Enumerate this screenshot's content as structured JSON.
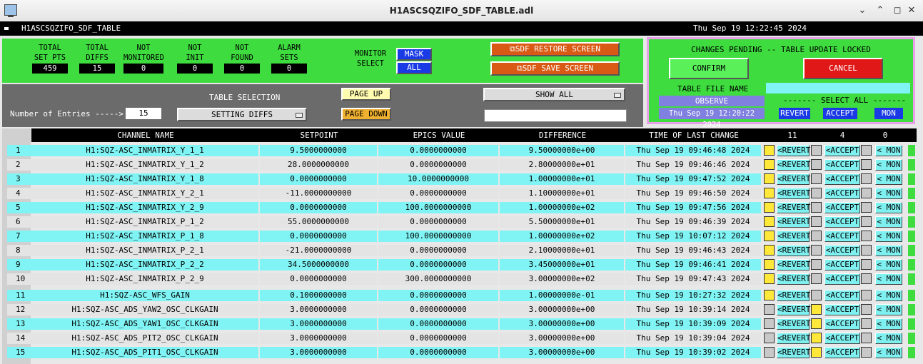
{
  "window": {
    "title": "H1ASCSQZIFO_SDF_TABLE.adl"
  },
  "header": {
    "screen_name": "H1ASCSQZIFO_SDF_TABLE",
    "datetime": "Thu Sep 19 12:22:45 2024"
  },
  "stats": [
    {
      "label": "TOTAL\nSET PTS",
      "value": "459"
    },
    {
      "label": "TOTAL\nDIFFS",
      "value": "15"
    },
    {
      "label": "NOT\nMONITORED",
      "value": "0"
    },
    {
      "label": "NOT\nINIT",
      "value": "0"
    },
    {
      "label": "NOT\nFOUND",
      "value": "0"
    },
    {
      "label": "ALARM\nSETS",
      "value": "0"
    }
  ],
  "monitor_select": {
    "label1": "MONITOR",
    "label2": "SELECT",
    "mask": "MASK",
    "all": "ALL"
  },
  "screens": {
    "restore": "SDF RESTORE SCREEN",
    "save": "SDF SAVE SCREEN"
  },
  "pending": {
    "title": "CHANGES PENDING -- TABLE UPDATE LOCKED",
    "confirm": "CONFIRM",
    "cancel": "CANCEL",
    "file_label": "TABLE FILE NAME",
    "file_value": "OBSERVE",
    "file_time": "Thu Sep 19 12:20:22 2024",
    "select_all": "------- SELECT ALL -------",
    "revert": "REVERT",
    "accept": "ACCEPT",
    "mon": "MON"
  },
  "table_controls": {
    "entries_label": "Number of Entries ----->",
    "entries_value": "15",
    "selection_label": "TABLE SELECTION",
    "selection_value": "SETTING DIFFS",
    "page_up": "PAGE UP",
    "page_down": "PAGE DOWN",
    "show_all": "SHOW ALL"
  },
  "columns": {
    "channel": "CHANNEL NAME",
    "setpoint": "SETPOINT",
    "epics": "EPICS VALUE",
    "difference": "DIFFERENCE",
    "time": "TIME OF LAST CHANGE",
    "count_revert": "11",
    "count_accept": "4",
    "count_mon": "0"
  },
  "row_buttons": {
    "revert": "<REVERT",
    "accept": "<ACCEPT",
    "mon": "< MON"
  },
  "rows": [
    {
      "n": "1",
      "ch": "H1:SQZ-ASC_INMATRIX_Y_1_1",
      "sp": "9.5000000000",
      "ev": "0.0000000000",
      "diff": "9.50000000e+00",
      "time": "Thu Sep 19 09:46:48 2024",
      "rev": true,
      "acc": false
    },
    {
      "n": "2",
      "ch": "H1:SQZ-ASC_INMATRIX_Y_1_2",
      "sp": "28.0000000000",
      "ev": "0.0000000000",
      "diff": "2.80000000e+01",
      "time": "Thu Sep 19 09:46:46 2024",
      "rev": true,
      "acc": false
    },
    {
      "n": "3",
      "ch": "H1:SQZ-ASC_INMATRIX_Y_1_8",
      "sp": "0.0000000000",
      "ev": "10.0000000000",
      "diff": "1.00000000e+01",
      "time": "Thu Sep 19 09:47:52 2024",
      "rev": true,
      "acc": false
    },
    {
      "n": "4",
      "ch": "H1:SQZ-ASC_INMATRIX_Y_2_1",
      "sp": "-11.0000000000",
      "ev": "0.0000000000",
      "diff": "1.10000000e+01",
      "time": "Thu Sep 19 09:46:50 2024",
      "rev": true,
      "acc": false
    },
    {
      "n": "5",
      "ch": "H1:SQZ-ASC_INMATRIX_Y_2_9",
      "sp": "0.0000000000",
      "ev": "100.0000000000",
      "diff": "1.00000000e+02",
      "time": "Thu Sep 19 09:47:56 2024",
      "rev": true,
      "acc": false
    },
    {
      "n": "6",
      "ch": "H1:SQZ-ASC_INMATRIX_P_1_2",
      "sp": "55.0000000000",
      "ev": "0.0000000000",
      "diff": "5.50000000e+01",
      "time": "Thu Sep 19 09:46:39 2024",
      "rev": true,
      "acc": false
    },
    {
      "n": "7",
      "ch": "H1:SQZ-ASC_INMATRIX_P_1_8",
      "sp": "0.0000000000",
      "ev": "100.0000000000",
      "diff": "1.00000000e+02",
      "time": "Thu Sep 19 10:07:12 2024",
      "rev": true,
      "acc": false
    },
    {
      "n": "8",
      "ch": "H1:SQZ-ASC_INMATRIX_P_2_1",
      "sp": "-21.0000000000",
      "ev": "0.0000000000",
      "diff": "2.10000000e+01",
      "time": "Thu Sep 19 09:46:43 2024",
      "rev": true,
      "acc": false
    },
    {
      "n": "9",
      "ch": "H1:SQZ-ASC_INMATRIX_P_2_2",
      "sp": "34.5000000000",
      "ev": "0.0000000000",
      "diff": "3.45000000e+01",
      "time": "Thu Sep 19 09:46:41 2024",
      "rev": true,
      "acc": false
    },
    {
      "n": "10",
      "ch": "H1:SQZ-ASC_INMATRIX_P_2_9",
      "sp": "0.0000000000",
      "ev": "300.0000000000",
      "diff": "3.00000000e+02",
      "time": "Thu Sep 19 09:47:43 2024",
      "rev": true,
      "acc": false
    },
    {
      "n": "11",
      "ch": "H1:SQZ-ASC_WFS_GAIN",
      "sp": "0.1000000000",
      "ev": "0.0000000000",
      "diff": "1.00000000e-01",
      "time": "Thu Sep 19 10:27:32 2024",
      "rev": true,
      "acc": false
    },
    {
      "n": "12",
      "ch": "H1:SQZ-ASC_ADS_YAW2_OSC_CLKGAIN",
      "sp": "3.0000000000",
      "ev": "0.0000000000",
      "diff": "3.00000000e+00",
      "time": "Thu Sep 19 10:39:14 2024",
      "rev": false,
      "acc": true
    },
    {
      "n": "13",
      "ch": "H1:SQZ-ASC_ADS_YAW1_OSC_CLKGAIN",
      "sp": "3.0000000000",
      "ev": "0.0000000000",
      "diff": "3.00000000e+00",
      "time": "Thu Sep 19 10:39:09 2024",
      "rev": false,
      "acc": true
    },
    {
      "n": "14",
      "ch": "H1:SQZ-ASC_ADS_PIT2_OSC_CLKGAIN",
      "sp": "3.0000000000",
      "ev": "0.0000000000",
      "diff": "3.00000000e+00",
      "time": "Thu Sep 19 10:39:04 2024",
      "rev": false,
      "acc": true
    },
    {
      "n": "15",
      "ch": "H1:SQZ-ASC_ADS_PIT1_OSC_CLKGAIN",
      "sp": "3.0000000000",
      "ev": "0.0000000000",
      "diff": "3.00000000e+00",
      "time": "Thu Sep 19 10:39:02 2024",
      "rev": false,
      "acc": true
    }
  ],
  "colors": {
    "panel_green": "#3edc3e",
    "row_cyan": "#80f4f4",
    "row_grey": "#e4e4e4",
    "pending_yellow": "#ffe83a",
    "cancel_red": "#e01818",
    "confirm_green": "#5af05a"
  }
}
